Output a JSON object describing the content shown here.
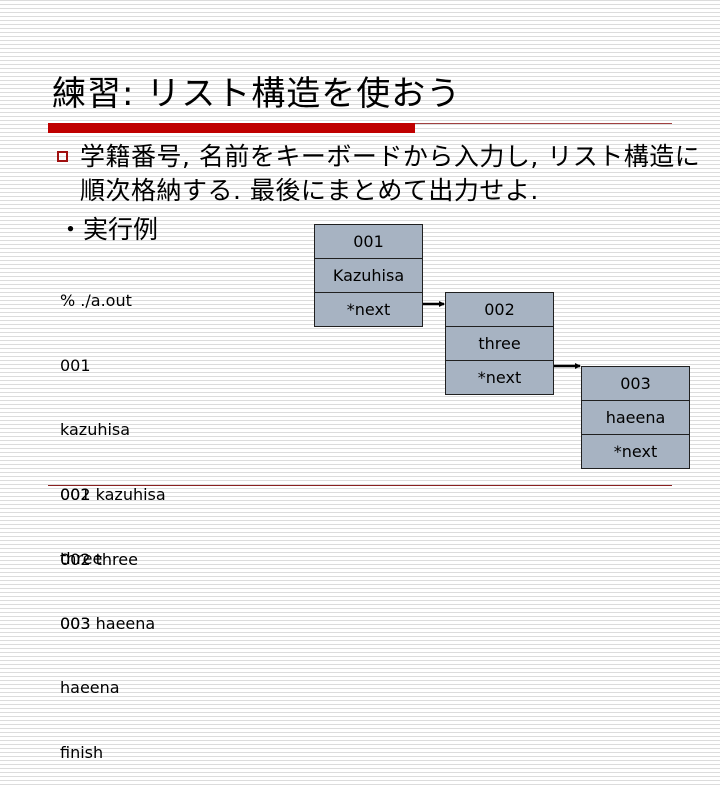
{
  "slide": {
    "title": "練習: リスト構造を使おう",
    "bullet": {
      "line1": "学籍番号, 名前をキーボードから入力し, リスト構造に",
      "line2": "順次格納する. 最後にまとめて出力せよ."
    },
    "example_label": "・実行例",
    "console_input": [
      "% ./a.out",
      "001",
      "kazuhisa",
      "002",
      "three",
      "003",
      "haeena",
      "finish"
    ],
    "console_output": [
      "001 kazuhisa",
      "002 three",
      "003 haeena"
    ]
  },
  "diagram": {
    "nodes": [
      {
        "id": "001",
        "name": "Kazuhisa",
        "pointer": "*next"
      },
      {
        "id": "002",
        "name": "three",
        "pointer": "*next"
      },
      {
        "id": "003",
        "name": "haeena",
        "pointer": "*next"
      }
    ],
    "colors": {
      "node_fill": "#a7b3c2",
      "node_border": "#202020",
      "accent_red": "#c00000"
    }
  }
}
